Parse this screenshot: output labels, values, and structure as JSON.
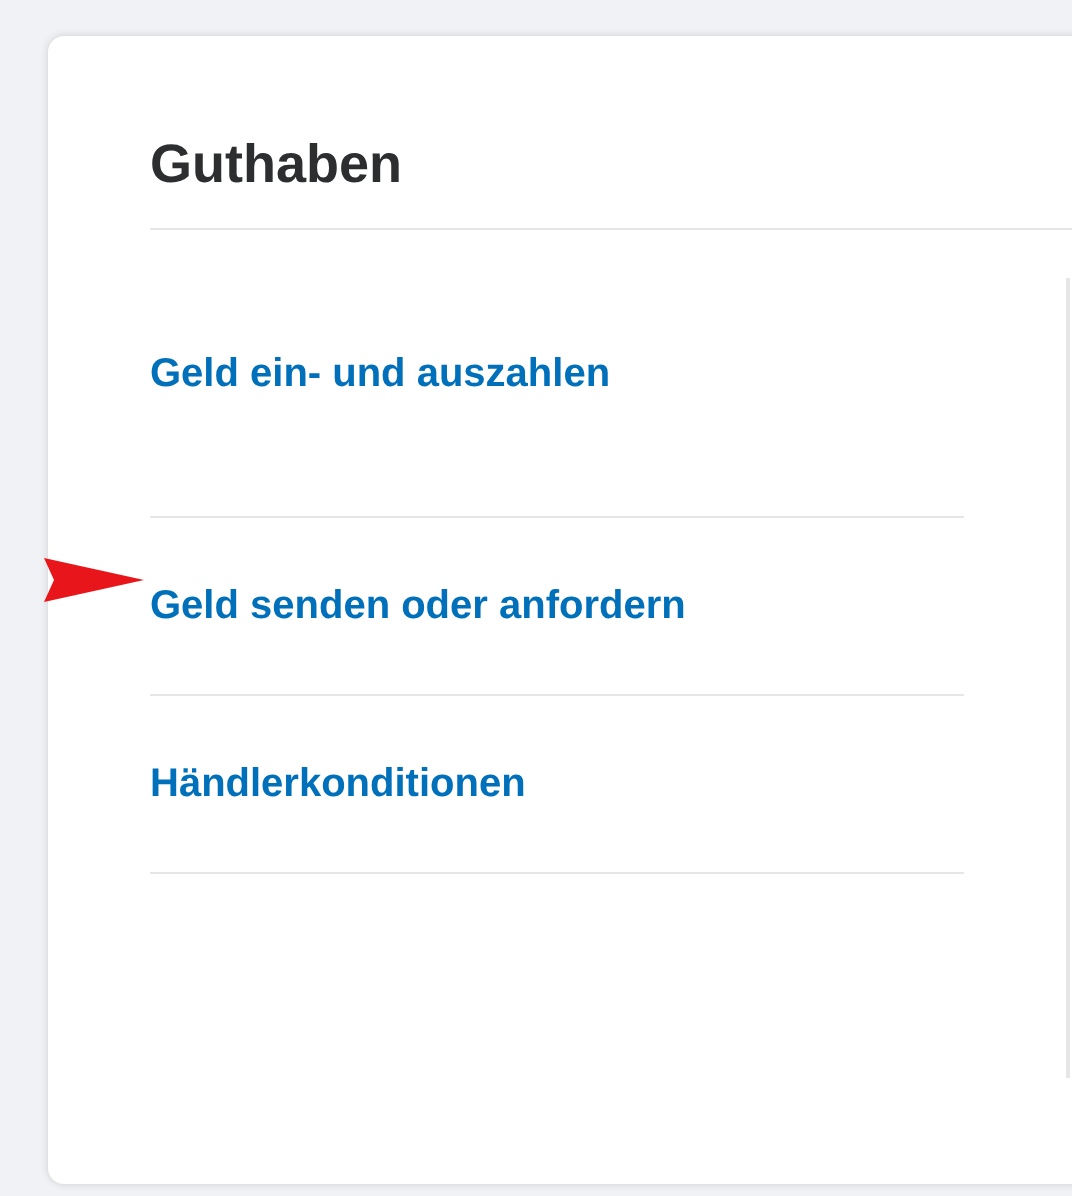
{
  "card": {
    "title": "Guthaben"
  },
  "links": [
    {
      "label": "Geld ein- und auszahlen",
      "arrow": false
    },
    {
      "label": "Geld senden oder anfordern",
      "arrow": true
    },
    {
      "label": "Händlerkonditionen",
      "arrow": false
    }
  ]
}
